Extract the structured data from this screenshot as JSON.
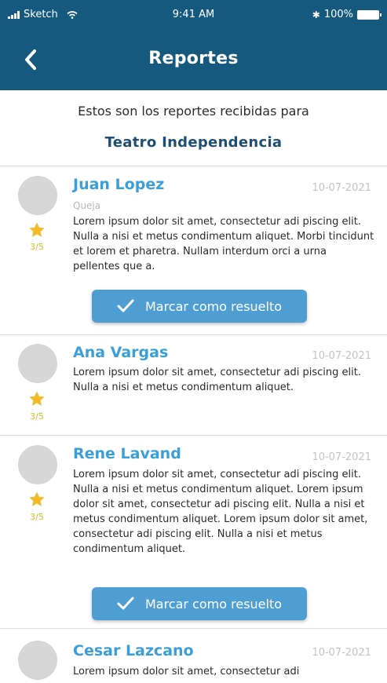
{
  "status_bar": {
    "carrier": "Sketch",
    "time": "9:41 AM",
    "battery": "100%"
  },
  "nav": {
    "title": "Reportes",
    "back_icon": "chevron-left-icon"
  },
  "intro": {
    "text": "Estos son los reportes recibidas para",
    "venue": "Teatro Independencia"
  },
  "colors": {
    "primary": "#16597f",
    "accent": "#3a9fd8",
    "button": "#4f9ed3",
    "star": "#e9b22a"
  },
  "reports": [
    {
      "name": "Juan Lopez",
      "date": "10-07-2021",
      "type": "Queja",
      "rating": "3/5",
      "text": "Lorem ipsum dolor sit amet, consectetur adi piscing elit. Nulla a nisi et metus condimentum aliquet. Morbi tincidunt et lorem et pharetra. Nullam interdum orci a urna pellentes que a.",
      "button": "Marcar como resuelto"
    },
    {
      "name": "Ana Vargas",
      "date": "10-07-2021",
      "rating": "3/5",
      "text": "Lorem ipsum dolor sit amet, consectetur adi piscing elit. Nulla a nisi et metus condimentum aliquet."
    },
    {
      "name": "Rene Lavand",
      "date": "10-07-2021",
      "rating": "3/5",
      "text": "Lorem ipsum dolor sit amet, consectetur adi piscing elit. Nulla a nisi et metus condimentum aliquet. Lorem ipsum dolor sit amet, consectetur adi piscing elit. Nulla a nisi et metus condimentum aliquet. Lorem ipsum dolor sit amet, consectetur adi piscing elit. Nulla a nisi et metus condimentum aliquet.",
      "button": "Marcar como resuelto"
    },
    {
      "name": "Cesar Lazcano",
      "date": "10-07-2021",
      "text": "Lorem ipsum dolor sit amet, consectetur adi"
    }
  ]
}
